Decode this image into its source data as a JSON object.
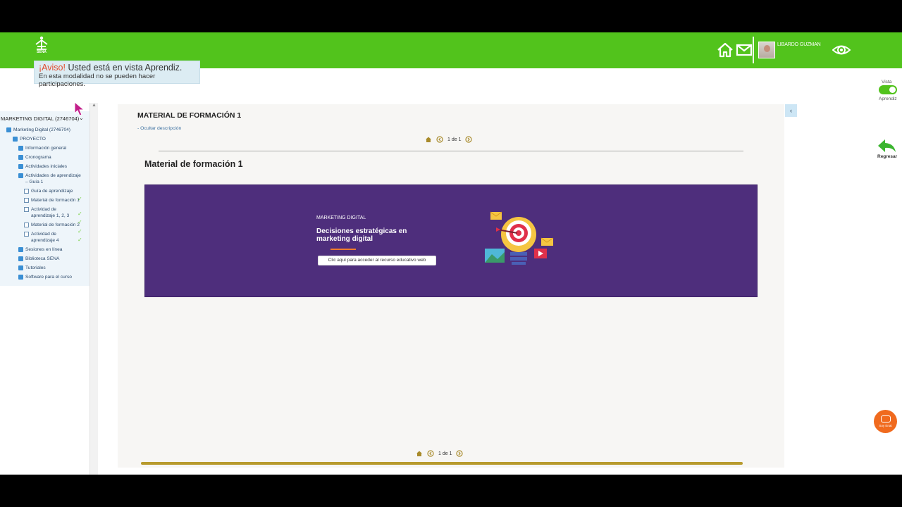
{
  "header": {
    "brand_icon": "sena-logo",
    "home_icon": "home-icon",
    "mail_icon": "mail-icon",
    "user_name": "LIBARDO GUZMAN",
    "view_icon": "eye-icon",
    "bar_color": "#52c31c"
  },
  "notice": {
    "strong": "¡Aviso!",
    "text": " Usted está en vista Aprendiz.",
    "subtext": "En esta modalidad no se pueden hacer participaciones."
  },
  "sidebar": {
    "course_title": "MARKETING DIGITAL (2746704)",
    "items": [
      {
        "label": "Marketing Digital (2746704)",
        "type": "folder"
      },
      {
        "label": "PROYECTO",
        "type": "folder"
      },
      {
        "label": "Información general",
        "type": "folder"
      },
      {
        "label": "Cronograma",
        "type": "folder"
      },
      {
        "label": "Actividades iniciales",
        "type": "folder"
      },
      {
        "label": "Actividades de aprendizaje",
        "label2": "– Guía 1",
        "type": "folder"
      },
      {
        "label": "Guía de aprendizaje",
        "type": "doc",
        "checked": true
      },
      {
        "label": "Material de formación 1",
        "type": "doc"
      },
      {
        "label": "Actividad de",
        "label2": "aprendizaje 1, 2, 3",
        "type": "doc",
        "checked": true
      },
      {
        "label": "Material de formación 2",
        "type": "doc"
      },
      {
        "label": "Actividad de",
        "label2": "aprendizaje 4",
        "type": "doc",
        "checked": true
      },
      {
        "label": "Sesiones en línea",
        "type": "folder"
      },
      {
        "label": "Biblioteca SENA",
        "type": "folder"
      },
      {
        "label": "Tutoriales",
        "type": "folder"
      },
      {
        "label": "Software para el curso",
        "type": "folder"
      }
    ]
  },
  "content": {
    "title": "MATERIAL DE FORMACIÓN 1",
    "hide_description": "- Ocultar descripción",
    "pager_text": "1 de 1",
    "section_title": "Material de formación 1",
    "banner": {
      "kicker": "MARKETING DIGITAL",
      "title": "Decisiones estratégicas en marketing digital",
      "button": "Clic aquí para acceder al recurso educativo web",
      "bg_color": "#4e2e7c",
      "accent_color": "#f07b2c"
    }
  },
  "right_panel": {
    "vista": "Vista",
    "aprendiz": "Aprendiz",
    "regresar": "Regresar",
    "chat_label": "Soy Enat"
  }
}
